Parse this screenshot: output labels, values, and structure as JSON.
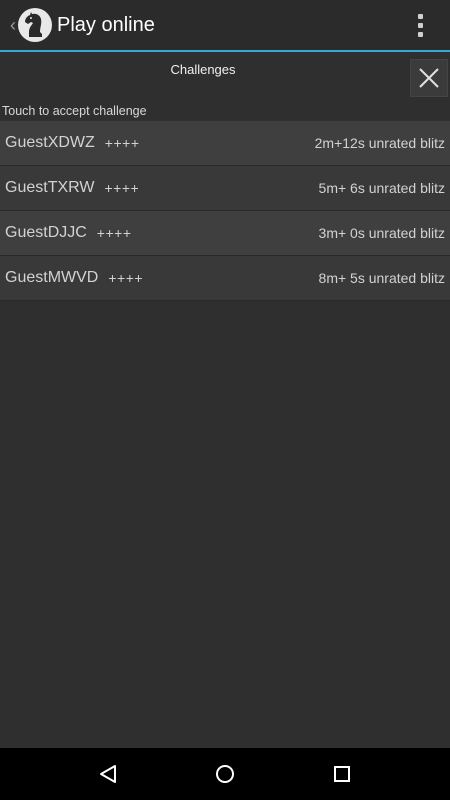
{
  "action_bar": {
    "title": "Play online",
    "up_icon": "chevron-left-icon",
    "logo_icon": "chess-knight-icon",
    "overflow_icon": "more-vert-icon"
  },
  "dialog": {
    "title": "Challenges",
    "close_icon": "close-icon",
    "hint": "Touch to accept challenge"
  },
  "challenges": [
    {
      "name": "GuestXDWZ",
      "rating": "++++",
      "details": "2m+12s unrated blitz"
    },
    {
      "name": "GuestTXRW",
      "rating": "++++",
      "details": "5m+ 6s unrated blitz"
    },
    {
      "name": "GuestDJJC",
      "rating": "++++",
      "details": "3m+ 0s unrated blitz"
    },
    {
      "name": "GuestMWVD",
      "rating": "++++",
      "details": "8m+ 5s unrated blitz"
    }
  ],
  "nav_bar": {
    "back_icon": "back-triangle-icon",
    "home_icon": "home-circle-icon",
    "recents_icon": "recents-square-icon"
  },
  "colors": {
    "accent": "#34a9d7",
    "background": "#2f2f2f",
    "row_odd": "#3f3f3f",
    "row_even": "#393939"
  }
}
